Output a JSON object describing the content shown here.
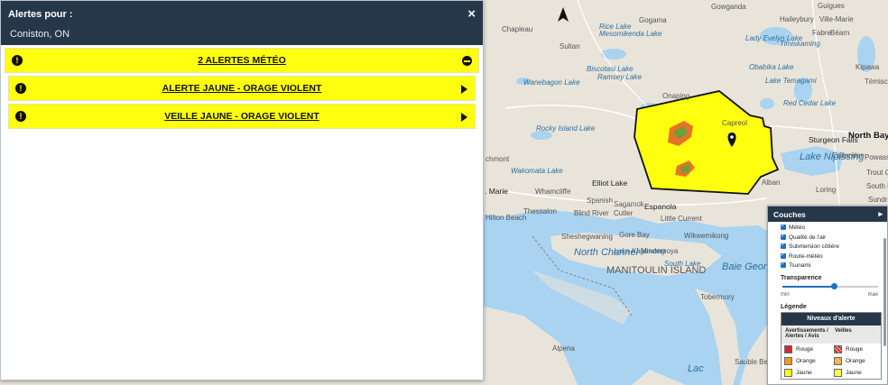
{
  "panel": {
    "title": "Alertes pour :",
    "close_icon": "×",
    "location": "Coniston, ON",
    "summary_label": "2 ALERTES MÉTÉO",
    "alerts": [
      {
        "label": "ALERTE JAUNE - ORAGE VIOLENT"
      },
      {
        "label": "VEILLE JAUNE - ORAGE VIOLENT"
      }
    ],
    "alert_color": "#ffff0f",
    "header_color": "#26374a"
  },
  "layers": {
    "title": "Couches",
    "items": [
      "Météo",
      "Qualité de l'air",
      "Submersion côtière",
      "Route-météo",
      "Tsunami"
    ],
    "transparency_label": "Transparence",
    "transparency_value": 0.55,
    "min_label": "min",
    "max_label": "max",
    "legend_label": "Légende",
    "legend": {
      "title": "Niveaux d'alerte",
      "col1": "Avertissements / Alertes / Avis",
      "col2": "Veilles",
      "rows": [
        {
          "label": "Rouge",
          "color": "#d12b2b"
        },
        {
          "label": "Orange",
          "color": "#f59a1b"
        },
        {
          "label": "Jaune",
          "color": "#ffff0f"
        }
      ]
    }
  },
  "map": {
    "labels": [
      "Gowganda",
      "Guigues",
      "Haileybury",
      "Ville-Marie",
      "Gogama",
      "Chapleau",
      "Rice Lake",
      "Mesomikenda Lake",
      "Lady Evelyn Lake",
      "Fabre",
      "Béarn",
      "Timiskaming",
      "Sultan",
      "Biscotasi Lake",
      "Obabika Lake",
      "Kipawa",
      "Ramsey Lake",
      "Lake Temagami",
      "Témiscamingue",
      "Wanebagon Lake",
      "Onaping",
      "Red Cedar Lake",
      "Rocky Island Lake",
      "Capreol",
      "Sturgeon Falls",
      "North Bay",
      "Lake Nipissing",
      "Callander",
      "Powassan",
      "chmont",
      "Wakomata Lake",
      "Trout Creek",
      "Elliot Lake",
      "Alban",
      "Loring",
      "South River",
      "Sundridge",
      "Espanola",
      "Sagamok",
      "Spanish",
      ". Marie",
      "Whamcliffe",
      "Thessalon",
      "Blind River",
      "Cutler",
      "Little Current",
      "Hilton Beach",
      "Sheshegwaning",
      "Gore Bay",
      "Mindemoya",
      "Wikwemikong",
      "North Channel",
      "Lake Kagawong",
      "South Lake",
      "MANITOULIN ISLAND",
      "Baie Georgienne",
      "Tobermory",
      "Alpena",
      "Sauble Beach",
      "Lac"
    ]
  }
}
